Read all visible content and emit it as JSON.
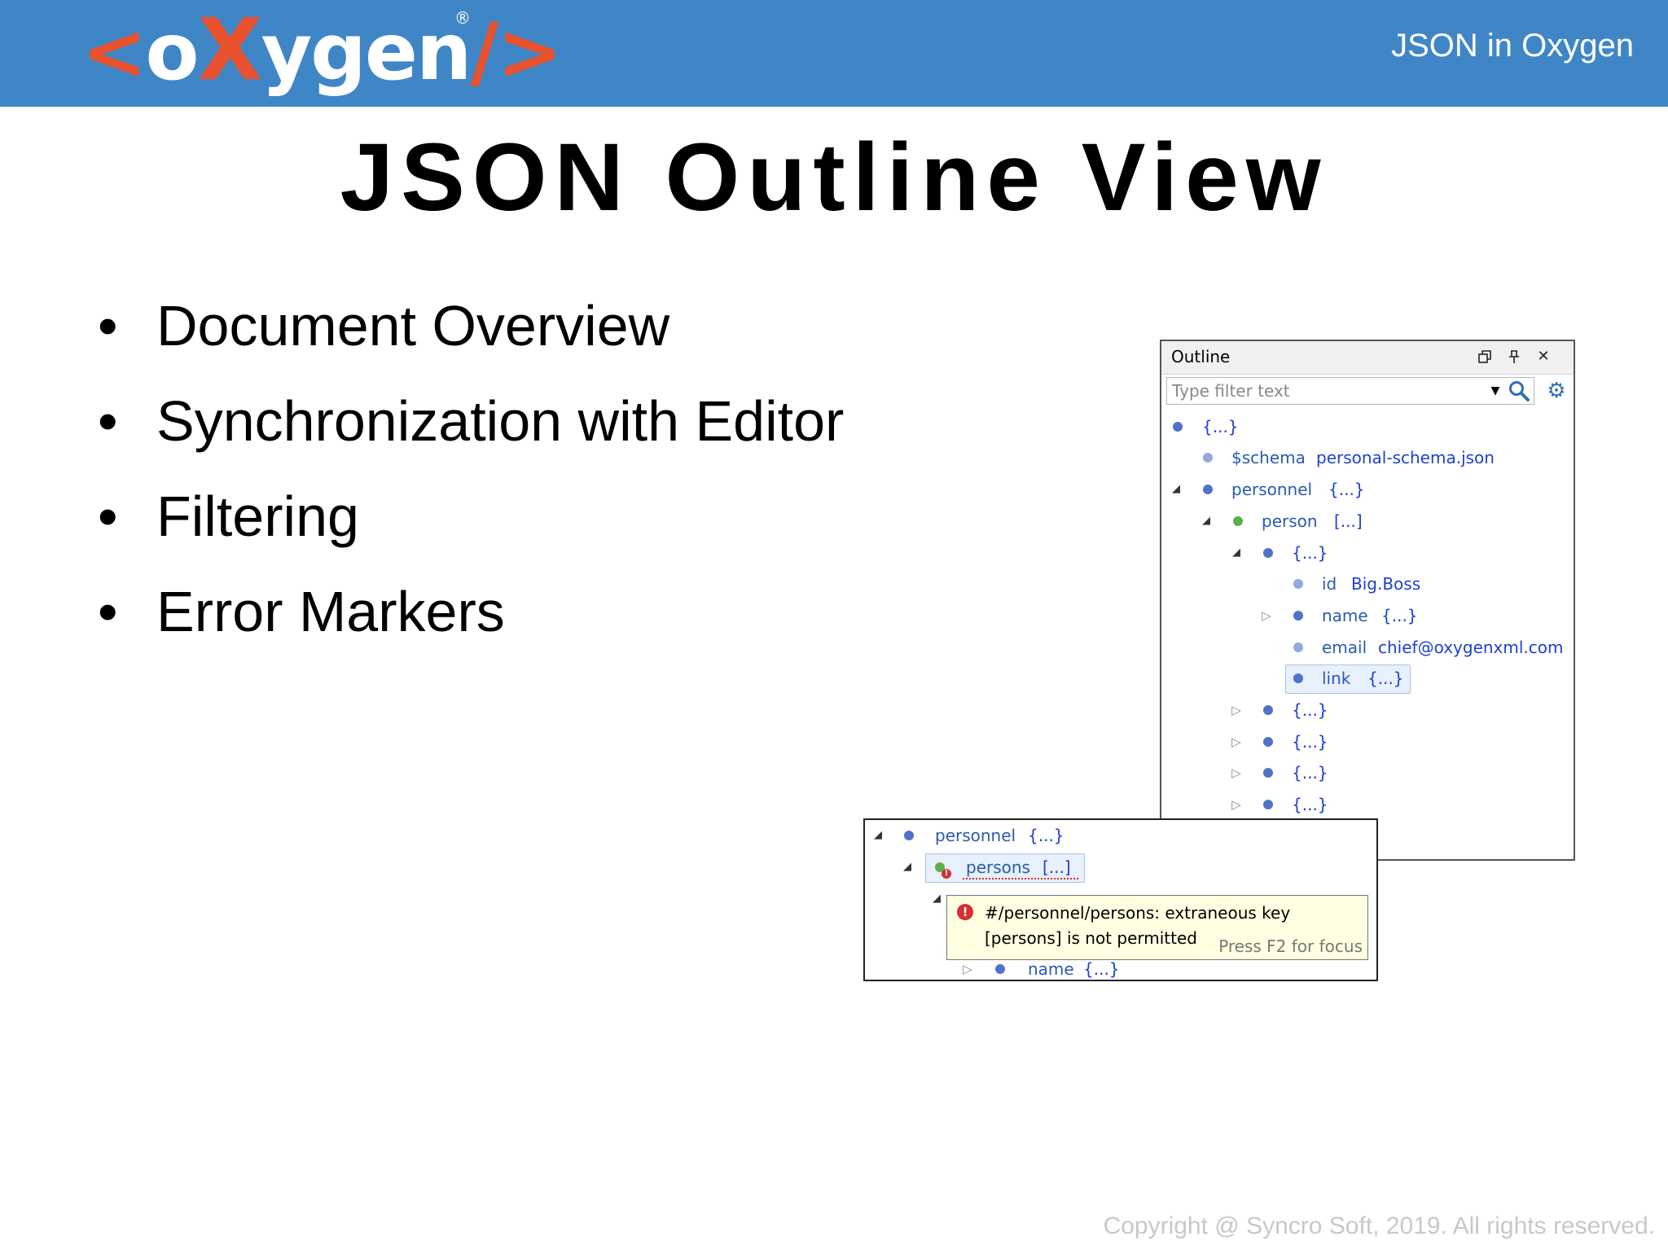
{
  "header": {
    "logo_text": "<oXygen/>",
    "title": "JSON in Oxygen",
    "brand_color": "#3f86c7",
    "accent_color": "#e8522e"
  },
  "slide": {
    "title": "JSON Outline View",
    "bullets": [
      "Document Overview",
      "Synchronization with Editor",
      "Filtering",
      "Error Markers"
    ]
  },
  "outline": {
    "title": "Outline",
    "filter_placeholder": "Type filter text",
    "icons": [
      "restore-icon",
      "pin-icon",
      "close-icon",
      "dropdown-arrow-icon",
      "search-icon",
      "gear-icon"
    ],
    "tree": [
      {
        "key": "",
        "value": "{...}"
      },
      {
        "key": "$schema",
        "value": "personal-schema.json"
      },
      {
        "key": "personnel",
        "value": "{...}"
      },
      {
        "key": "person",
        "value": "[...]"
      },
      {
        "key": "",
        "value": "{...}"
      },
      {
        "key": "id",
        "value": "Big.Boss"
      },
      {
        "key": "name",
        "value": "{...}"
      },
      {
        "key": "email",
        "value": "chief@oxygenxml.com"
      },
      {
        "key": "link",
        "value": "{...}"
      },
      {
        "key": "",
        "value": "{...}"
      },
      {
        "key": "",
        "value": "{...}"
      },
      {
        "key": "",
        "value": "{...}"
      },
      {
        "key": "",
        "value": "{...}"
      }
    ]
  },
  "error_inset": {
    "rows": [
      {
        "key": "personnel",
        "value": "{...}"
      },
      {
        "key": "persons",
        "value": "[...]"
      },
      {
        "key": "name",
        "value": "{...}"
      }
    ],
    "tooltip_line1": "#/personnel/persons: extraneous key",
    "tooltip_line2": "[persons] is not permitted",
    "tooltip_hint": "Press F2 for focus"
  },
  "footer": {
    "copyright": "Copyright @ Syncro Soft, 2019. All rights reserved."
  }
}
